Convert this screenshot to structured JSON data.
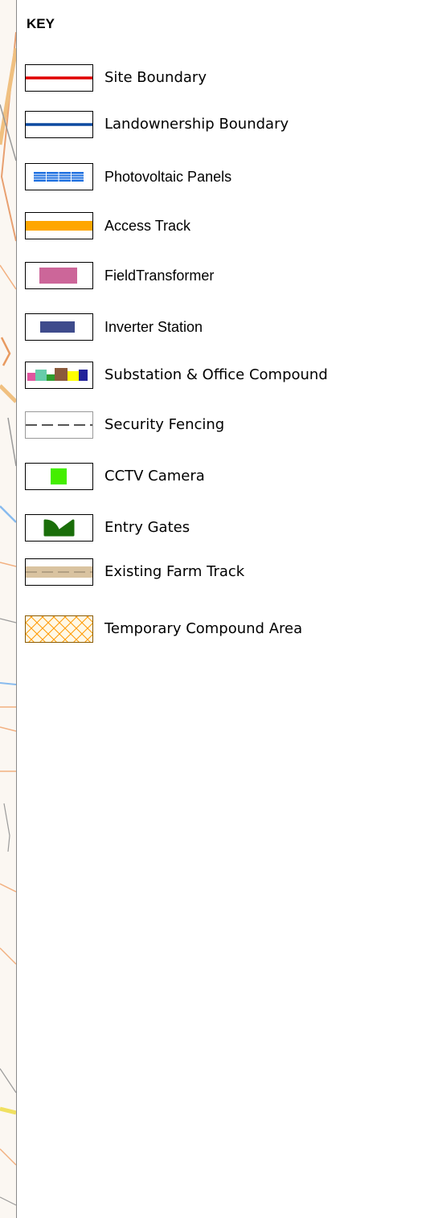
{
  "title": "KEY",
  "items": [
    {
      "id": "site-boundary",
      "label": "Site Boundary",
      "color": "#e00000"
    },
    {
      "id": "landownership-boundary",
      "label": "Landownership Boundary",
      "color": "#0d4aa0"
    },
    {
      "id": "photovoltaic-panels",
      "label": "Photovoltaic Panels",
      "color": "#1c6fe0"
    },
    {
      "id": "access-track",
      "label": "Access Track",
      "color": "#ffa600"
    },
    {
      "id": "field-transformer",
      "label": "FieldTransformer",
      "color": "#cc6699"
    },
    {
      "id": "inverter-station",
      "label": "Inverter Station",
      "color": "#3e4b8c"
    },
    {
      "id": "substation-office-compound",
      "label": "Substation & Office Compound",
      "colors": [
        "#e0559e",
        "#66ccaa",
        "#2e9e2e",
        "#8b5a3c",
        "#ffff00",
        "#22229a"
      ]
    },
    {
      "id": "security-fencing",
      "label": "Security Fencing",
      "color": "#555555"
    },
    {
      "id": "cctv-camera",
      "label": "CCTV Camera",
      "color": "#44ee00"
    },
    {
      "id": "entry-gates",
      "label": "Entry Gates",
      "color": "#1a6e0a"
    },
    {
      "id": "existing-farm-track",
      "label": "Existing Farm Track",
      "color": "#d9c3a0"
    },
    {
      "id": "temporary-compound-area",
      "label": "Temporary Compound Area",
      "color": "#ff9900"
    }
  ]
}
